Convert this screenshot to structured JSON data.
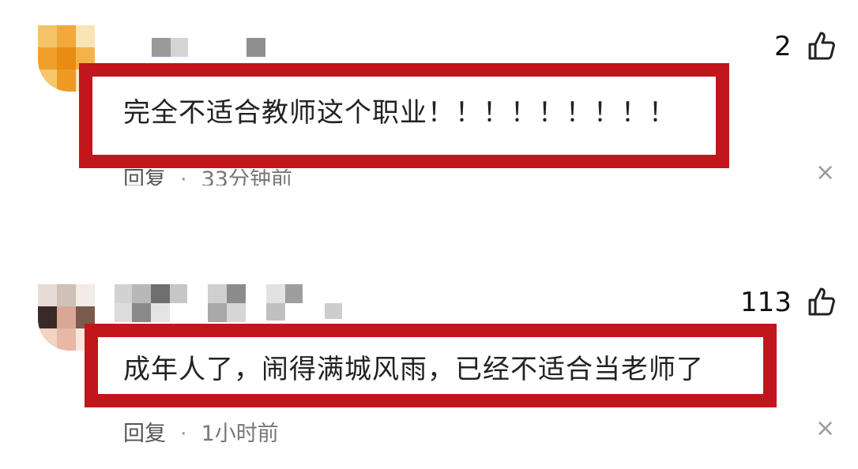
{
  "comments": [
    {
      "text": "完全不适合教师这个职业！！！！！！！！！",
      "likes": "2",
      "reply_label": "回复",
      "time": "33分钟前",
      "separator": "·",
      "close_glyph": "×"
    },
    {
      "text": "成年人了，闹得满城风雨，已经不适合当老师了",
      "likes": "113",
      "reply_label": "回复",
      "time": "1小时前",
      "separator": "·",
      "close_glyph": "×"
    }
  ],
  "colors": {
    "highlight_border": "#c0161c",
    "text": "#222222",
    "meta": "#555555"
  },
  "icons": [
    "like-icon",
    "close-icon"
  ]
}
